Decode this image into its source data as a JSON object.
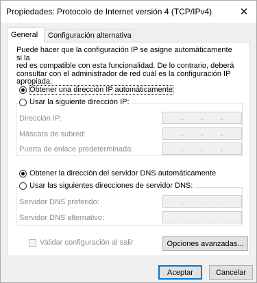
{
  "window": {
    "title": "Propiedades: Protocolo de Internet versión 4 (TCP/IPv4)",
    "close_glyph": "✕"
  },
  "tabs": [
    {
      "label": "General",
      "active": true
    },
    {
      "label": "Configuración alternativa",
      "active": false
    }
  ],
  "general": {
    "description": [
      "Puede hacer que la configuración IP se asigne automáticamente si la",
      "red es compatible con esta funcionalidad. De lo contrario, deberá",
      "consultar con el administrador de red cuál es la configuración IP",
      "apropiada."
    ],
    "ip_auto_label": "Obtener una dirección IP automáticamente",
    "ip_auto_selected": true,
    "ip_manual_label": "Usar la siguiente dirección IP:",
    "ip_fields": [
      {
        "label": "Dirección IP:",
        "value": ". . ."
      },
      {
        "label": "Máscara de subred:",
        "value": ". . ."
      },
      {
        "label": "Puerta de enlace predeterminada:",
        "value": ". . ."
      }
    ],
    "dns_auto_label": "Obtener la dirección del servidor DNS automáticamente",
    "dns_auto_selected": true,
    "dns_manual_label": "Usar las siguientes direcciones de servidor DNS:",
    "dns_fields": [
      {
        "label": "Servidor DNS preferido:",
        "value": ". . ."
      },
      {
        "label": "Servidor DNS alternativo:",
        "value": ". . ."
      }
    ],
    "validate_label": "Validar configuración al salir",
    "validate_checked": false,
    "advanced_button": "Opciones avanzadas..."
  },
  "footer": {
    "ok_button": "Aceptar",
    "cancel_button": "Cancelar"
  }
}
